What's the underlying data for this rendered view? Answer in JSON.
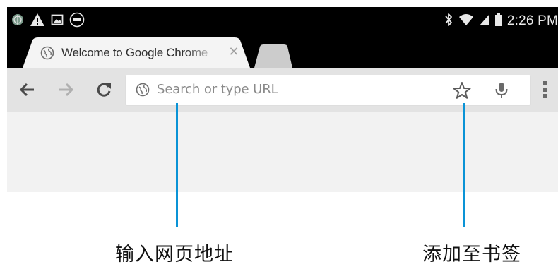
{
  "status_bar": {
    "time": "2:26 PM",
    "left_icons": [
      "network-globe-icon",
      "warning-icon",
      "image-icon",
      "dell-icon"
    ],
    "right_icons": [
      "bluetooth-icon",
      "wifi-icon",
      "signal-icon",
      "battery-icon"
    ]
  },
  "tabs": {
    "active_tab_title": "Welcome to Google Chrome",
    "close_glyph": "✕"
  },
  "toolbar": {
    "omnibox_placeholder": "Search or type URL"
  },
  "annotations": {
    "url_label": "输入网页地址",
    "bookmark_label": "添加至书签",
    "line_color": "#0a93d6"
  },
  "colors": {
    "status_bar_bg": "#000000",
    "toolbar_bg": "#e3e3e3",
    "content_bg": "#f2f2f2",
    "tab_bg": "#f4f4f4"
  }
}
